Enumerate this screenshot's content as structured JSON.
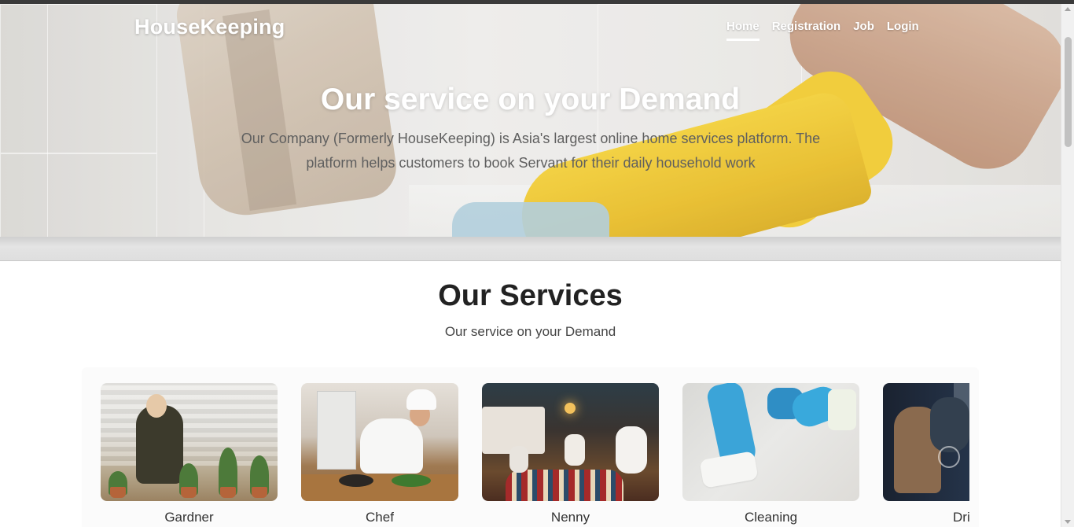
{
  "navbar": {
    "brand": "HouseKeeping",
    "links": [
      {
        "label": "Home",
        "active": true
      },
      {
        "label": "Registration",
        "active": false
      },
      {
        "label": "Job",
        "active": false
      },
      {
        "label": "Login",
        "active": false
      }
    ]
  },
  "hero": {
    "title": "Our service on your Demand",
    "text": "Our Company (Formerly HouseKeeping) is Asia's largest online home services platform. The platform helps customers to book Servant for their daily household work"
  },
  "services": {
    "title": "Our Services",
    "subtitle": "Our service on your Demand",
    "items": [
      {
        "label": "Gardner"
      },
      {
        "label": "Chef"
      },
      {
        "label": "Nenny"
      },
      {
        "label": "Cleaning"
      },
      {
        "label": "Driver"
      }
    ]
  },
  "colors": {
    "glove": "#f0c623",
    "text_dark": "#222222",
    "scroll_thumb": "#c1c1c1"
  }
}
